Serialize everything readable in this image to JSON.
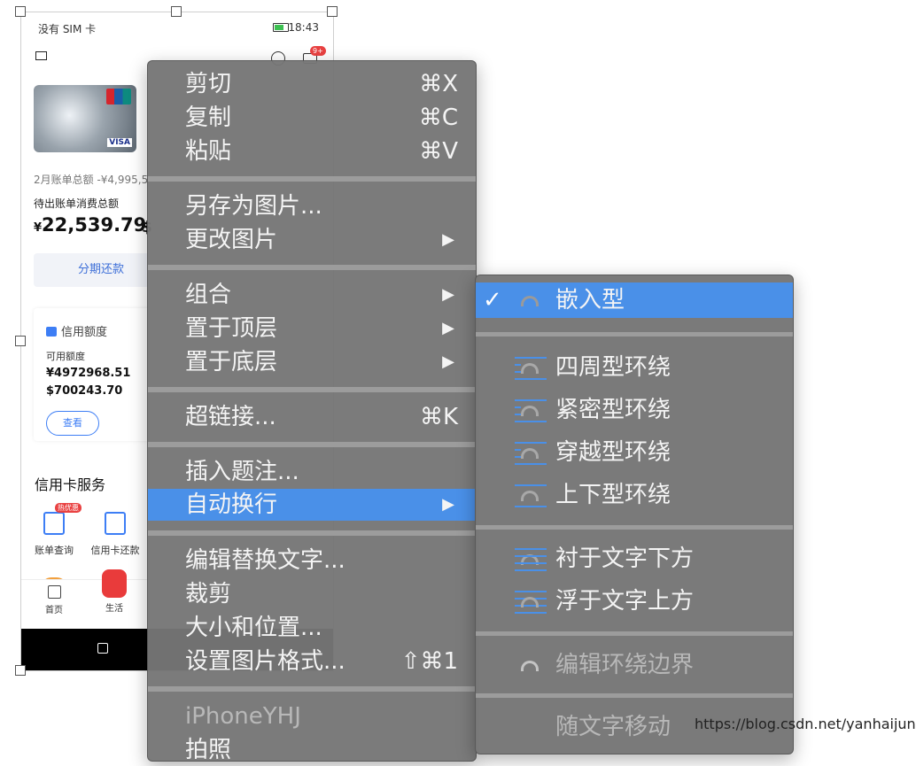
{
  "phone": {
    "status": {
      "carrier": "没有 SIM 卡",
      "time": "18:43"
    },
    "badge": "9+",
    "bill_line": "2月账单总额 -¥4,995,5",
    "pending_label": "待出账单消费总额",
    "amount_currency": "¥",
    "amount": "22,539.79",
    "amount_extra": "$",
    "install_button": "分期还款",
    "limit_title": "信用额度",
    "available_label": "可用额度",
    "available_cny": "¥4972968.51",
    "available_usd": "$700243.70",
    "view_button": "查看",
    "services_title": "信用卡服务",
    "hot_badge": "热优惠",
    "services": [
      "账单查询",
      "信用卡还款"
    ],
    "tabs": [
      "首页",
      "生活"
    ]
  },
  "menu": {
    "cut": {
      "label": "剪切",
      "shortcut": "⌘X"
    },
    "copy": {
      "label": "复制",
      "shortcut": "⌘C"
    },
    "paste": {
      "label": "粘贴",
      "shortcut": "⌘V"
    },
    "save_as_picture": {
      "label": "另存为图片..."
    },
    "change_picture": {
      "label": "更改图片",
      "arrow": "▶"
    },
    "group": {
      "label": "组合",
      "arrow": "▶"
    },
    "bring_to_front": {
      "label": "置于顶层",
      "arrow": "▶"
    },
    "send_to_back": {
      "label": "置于底层",
      "arrow": "▶"
    },
    "hyperlink": {
      "label": "超链接...",
      "shortcut": "⌘K"
    },
    "insert_caption": {
      "label": "插入题注..."
    },
    "wrap_text": {
      "label": "自动换行",
      "arrow": "▶"
    },
    "edit_alt_text": {
      "label": "编辑替换文字..."
    },
    "crop": {
      "label": "裁剪"
    },
    "size_position": {
      "label": "大小和位置..."
    },
    "format_picture": {
      "label": "设置图片格式...",
      "shortcut": "⇧⌘1"
    },
    "service_header": {
      "label": "iPhoneYHJ"
    },
    "partial": {
      "label": "拍照"
    }
  },
  "submenu": {
    "check_mark": "✓",
    "inline": "嵌入型",
    "square": "四周型环绕",
    "tight": "紧密型环绕",
    "through": "穿越型环绕",
    "top_bottom": "上下型环绕",
    "behind_text": "衬于文字下方",
    "in_front_text": "浮于文字上方",
    "edit_wrap_boundary": "编辑环绕边界",
    "move_with_text": "随文字移动"
  },
  "watermark": "https://blog.csdn.net/yanhaijunyan",
  "colors": {
    "highlight": "#4a90e8",
    "menu_bg": "#767676",
    "accent_blue": "#3d7ef5",
    "badge_red": "#e94141"
  }
}
